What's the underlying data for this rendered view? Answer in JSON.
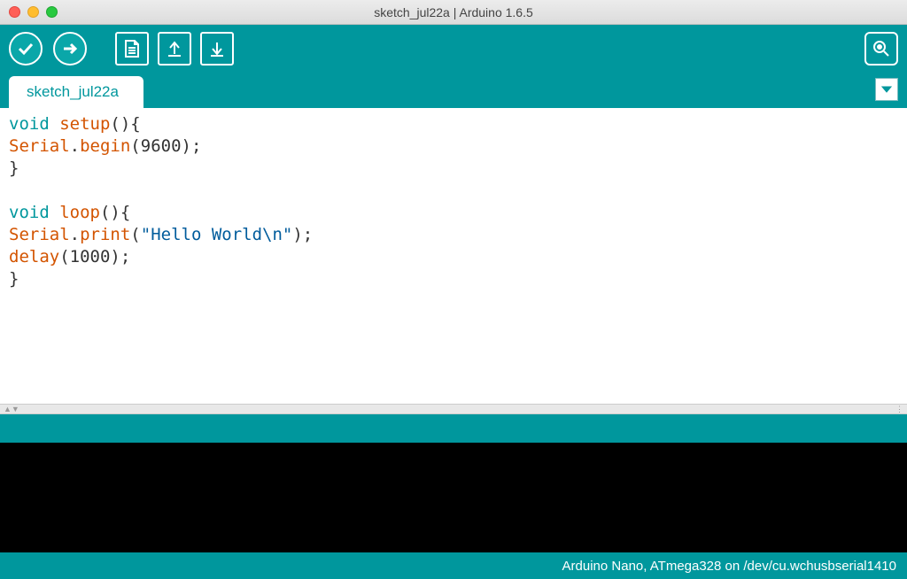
{
  "window": {
    "title": "sketch_jul22a | Arduino 1.6.5"
  },
  "tabs": {
    "active": "sketch_jul22a"
  },
  "code": {
    "tokens": [
      {
        "t": "kw",
        "v": "void"
      },
      {
        "t": "sp",
        "v": " "
      },
      {
        "t": "fn",
        "v": "setup"
      },
      {
        "t": "pl",
        "v": "(){"
      },
      {
        "t": "nl"
      },
      {
        "t": "pl",
        "v": "   "
      },
      {
        "t": "fn",
        "v": "Serial"
      },
      {
        "t": "pl",
        "v": "."
      },
      {
        "t": "fn",
        "v": "begin"
      },
      {
        "t": "pl",
        "v": "("
      },
      {
        "t": "num",
        "v": "9600"
      },
      {
        "t": "pl",
        "v": ");"
      },
      {
        "t": "nl"
      },
      {
        "t": "pl",
        "v": "}"
      },
      {
        "t": "nl"
      },
      {
        "t": "nl"
      },
      {
        "t": "kw",
        "v": "void"
      },
      {
        "t": "sp",
        "v": " "
      },
      {
        "t": "fn",
        "v": "loop"
      },
      {
        "t": "pl",
        "v": "(){"
      },
      {
        "t": "nl"
      },
      {
        "t": "pl",
        "v": "   "
      },
      {
        "t": "fn",
        "v": "Serial"
      },
      {
        "t": "pl",
        "v": "."
      },
      {
        "t": "fn",
        "v": "print"
      },
      {
        "t": "pl",
        "v": "("
      },
      {
        "t": "str",
        "v": "\"Hello World\\n\""
      },
      {
        "t": "pl",
        "v": ");"
      },
      {
        "t": "nl"
      },
      {
        "t": "pl",
        "v": "   "
      },
      {
        "t": "fn",
        "v": "delay"
      },
      {
        "t": "pl",
        "v": "("
      },
      {
        "t": "num",
        "v": "1000"
      },
      {
        "t": "pl",
        "v": ");"
      },
      {
        "t": "nl"
      },
      {
        "t": "pl",
        "v": "}"
      }
    ]
  },
  "footer": {
    "board_info": "Arduino Nano, ATmega328 on /dev/cu.wchusbserial1410"
  },
  "icons": {
    "verify": "verify-icon",
    "upload": "upload-icon",
    "new": "new-icon",
    "open": "open-icon",
    "save": "save-icon",
    "serial": "serial-monitor-icon",
    "tabmenu": "tab-menu-icon"
  }
}
